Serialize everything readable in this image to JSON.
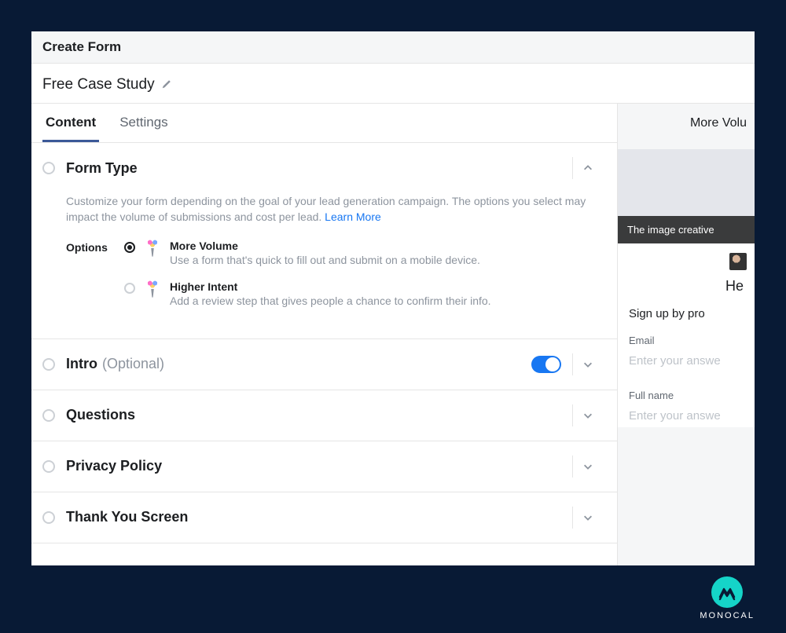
{
  "header": {
    "title": "Create Form"
  },
  "form_name": "Free Case Study",
  "tabs": [
    {
      "label": "Content",
      "active": true
    },
    {
      "label": "Settings",
      "active": false
    }
  ],
  "form_type": {
    "title": "Form Type",
    "description": "Customize your form depending on the goal of your lead generation campaign. The options you select may impact the volume of submissions and cost per lead. ",
    "learn_more": "Learn More",
    "options_label": "Options",
    "options": [
      {
        "title": "More Volume",
        "desc": "Use a form that's quick to fill out and submit on a mobile device.",
        "selected": true
      },
      {
        "title": "Higher Intent",
        "desc": "Add a review step that gives people a chance to confirm their info.",
        "selected": false
      }
    ]
  },
  "sections": [
    {
      "title": "Intro",
      "optional": "(Optional)",
      "toggle_on": true
    },
    {
      "title": "Questions"
    },
    {
      "title": "Privacy Policy"
    },
    {
      "title": "Thank You Screen"
    }
  ],
  "preview": {
    "header": "More Volu",
    "banner": "The image creative",
    "heading": "He",
    "subheading": "Sign up by pro",
    "fields": [
      {
        "label": "Email",
        "placeholder": "Enter your answe"
      },
      {
        "label": "Full name",
        "placeholder": "Enter your answe"
      }
    ]
  },
  "brand": "MONOCAL"
}
